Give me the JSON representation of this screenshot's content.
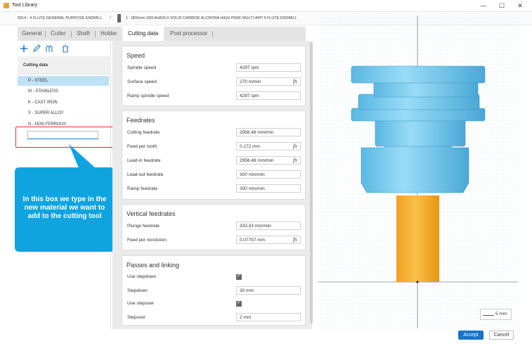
{
  "window": {
    "title": "Tool Library",
    "minimize_glyph": "—",
    "maximize_glyph": "☐",
    "close_glyph": "✕"
  },
  "breadcrumb": {
    "library": "5814 - 4 FLUTE GENERAL PURPOSE ENDMILL",
    "separator": "/",
    "tool": "1 - Ø20mm (5814HA20.0 SOLID CARBIDE ALCRONA HIGH PERF MULTI-APP 4 FLUTE ENDMILL"
  },
  "tabs": [
    {
      "label": "General"
    },
    {
      "label": "Cutter"
    },
    {
      "label": "Shaft"
    },
    {
      "label": "Holder"
    },
    {
      "label": "Cutting data"
    },
    {
      "label": "Post processor"
    }
  ],
  "left_panel": {
    "toolbar_icons": [
      "add-icon",
      "edit-icon",
      "copy-icon",
      "delete-icon"
    ],
    "header": "Cutting data",
    "materials": [
      {
        "label": "P - STEEL"
      },
      {
        "label": "M - STAINLESS"
      },
      {
        "label": "K - CAST IRON"
      },
      {
        "label": "S - SUPER ALLOY"
      },
      {
        "label": "N - NON FERROUS"
      }
    ],
    "new_material_value": ""
  },
  "annotation": {
    "text": "In this box we type in the new material we want to add to the cutting tool",
    "color": "#0fa4e0",
    "highlight_color": "#e0302f"
  },
  "form": {
    "speed": {
      "title": "Speed",
      "spindle_speed": {
        "label": "Spindle speed",
        "value": "4297 rpm"
      },
      "surface_speed": {
        "label": "Surface speed",
        "value": "270 m/min"
      },
      "ramp_spindle_speed": {
        "label": "Ramp spindle speed",
        "value": "4297 rpm"
      }
    },
    "feedrates": {
      "title": "Feedrates",
      "cutting_feedrate": {
        "label": "Cutting feedrate",
        "value": "2956.46 mm/min"
      },
      "feed_per_tooth": {
        "label": "Feed per tooth",
        "value": "0.172 mm"
      },
      "leadin_feedrate": {
        "label": "Lead-in feedrate",
        "value": "2956.46 mm/min"
      },
      "leadout_feedrate": {
        "label": "Lead-out feedrate",
        "value": "300 mm/min"
      },
      "ramp_feedrate": {
        "label": "Ramp feedrate",
        "value": "300 mm/min"
      }
    },
    "vertical_feedrates": {
      "title": "Vertical feedrates",
      "plunge_feedrate": {
        "label": "Plunge feedrate",
        "value": "333.33 mm/min"
      },
      "feed_per_revolution": {
        "label": "Feed per revolution",
        "value": "0.07757 mm"
      }
    },
    "passes": {
      "title": "Passes and linking",
      "use_stepdown": {
        "label": "Use stepdown",
        "checked": true
      },
      "stepdown": {
        "label": "Stepdown",
        "value": "30 mm"
      },
      "use_stepover": {
        "label": "Use stepover",
        "checked": true
      },
      "stepover": {
        "label": "Stepover",
        "value": "2 mm"
      }
    },
    "formula_glyph": "fx"
  },
  "viewport": {
    "scale_label": "5 mm",
    "holder_color": "#7fd0f2",
    "cutter_color": "#f5a623"
  },
  "footer": {
    "accept_label": "Accept",
    "cancel_label": "Cancel"
  }
}
